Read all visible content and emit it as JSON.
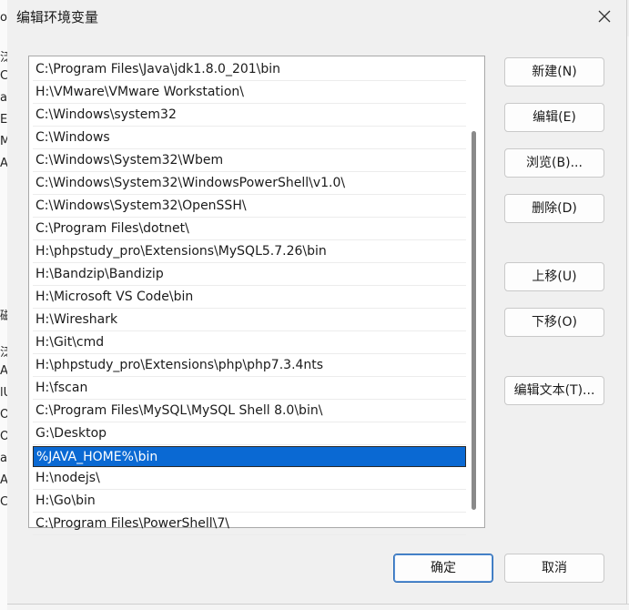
{
  "dialog": {
    "title": "编辑环境变量"
  },
  "list": {
    "items": [
      "C:\\Program Files\\Java\\jdk1.8.0_201\\bin",
      "H:\\VMware\\VMware Workstation\\",
      "C:\\Windows\\system32",
      "C:\\Windows",
      "C:\\Windows\\System32\\Wbem",
      "C:\\Windows\\System32\\WindowsPowerShell\\v1.0\\",
      "C:\\Windows\\System32\\OpenSSH\\",
      "C:\\Program Files\\dotnet\\",
      "H:\\phpstudy_pro\\Extensions\\MySQL5.7.26\\bin",
      "H:\\Bandzip\\Bandizip",
      "H:\\Microsoft VS Code\\bin",
      "H:\\Wireshark",
      "H:\\Git\\cmd",
      "H:\\phpstudy_pro\\Extensions\\php\\php7.3.4nts",
      "H:\\fscan",
      "C:\\Program Files\\MySQL\\MySQL Shell 8.0\\bin\\",
      "G:\\Desktop",
      "%JAVA_HOME%\\bin",
      "H:\\nodejs\\",
      "H:\\Go\\bin",
      "C:\\Program Files\\PowerShell\\7\\"
    ],
    "selected_value": "%JAVA_HOME%\\bin"
  },
  "buttons": {
    "new": "新建(N)",
    "edit": "编辑(E)",
    "browse": "浏览(B)...",
    "delete": "删除(D)",
    "move_up": "上移(U)",
    "move_down": "下移(O)",
    "edit_text": "编辑文本(T)...",
    "ok": "确定",
    "cancel": "取消"
  },
  "colors": {
    "selection": "#0a69d3",
    "default_button_border": "#2a6ab5"
  }
}
